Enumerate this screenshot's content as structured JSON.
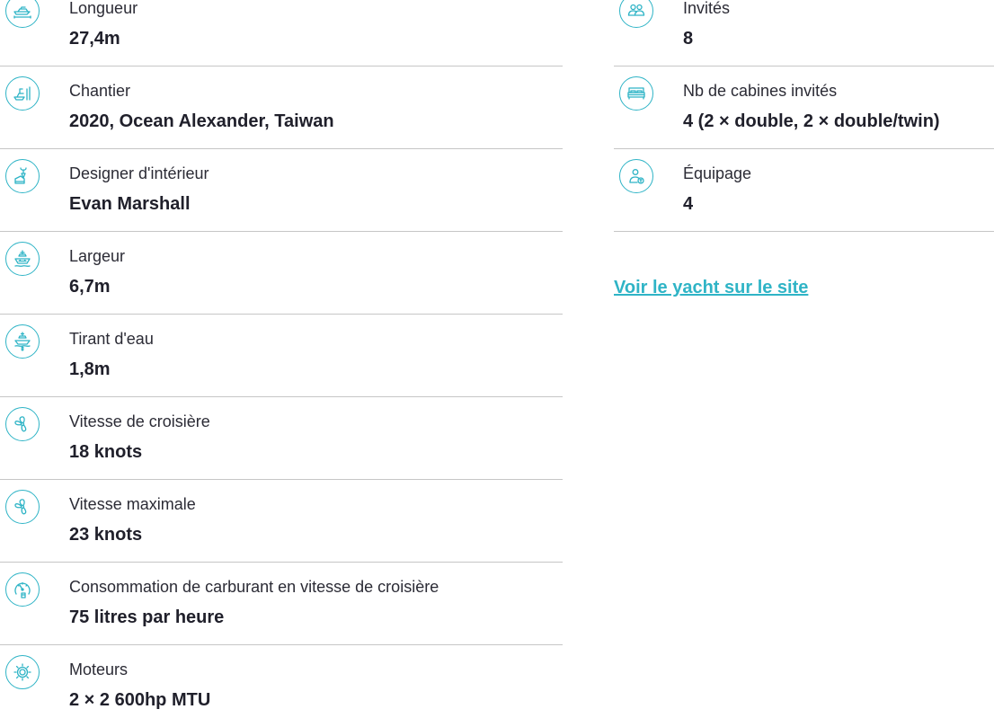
{
  "specs_left": [
    {
      "icon": "yacht-length-icon",
      "label": "Longueur",
      "value": "27,4m"
    },
    {
      "icon": "shipyard-icon",
      "label": "Chantier",
      "value": "2020, Ocean Alexander, Taiwan"
    },
    {
      "icon": "interior-designer-icon",
      "label": "Designer d'intérieur",
      "value": "Evan Marshall"
    },
    {
      "icon": "beam-width-icon",
      "label": "Largeur",
      "value": "6,7m"
    },
    {
      "icon": "draft-icon",
      "label": "Tirant d'eau",
      "value": "1,8m"
    },
    {
      "icon": "propeller-icon",
      "label": "Vitesse de croisière",
      "value": "18 knots"
    },
    {
      "icon": "propeller-icon",
      "label": "Vitesse maximale",
      "value": "23 knots"
    },
    {
      "icon": "fuel-gauge-icon",
      "label": "Consommation de carburant en vitesse de croisière",
      "value": "75 litres par heure"
    },
    {
      "icon": "engine-gear-icon",
      "label": "Moteurs",
      "value": "2 × 2 600hp MTU"
    }
  ],
  "specs_right": [
    {
      "icon": "guests-icon",
      "label": "Invités",
      "value": "8"
    },
    {
      "icon": "bed-icon",
      "label": "Nb de cabines invités",
      "value": "4 (2 × double, 2 × double/twin)"
    },
    {
      "icon": "crew-icon",
      "label": "Équipage",
      "value": "4"
    }
  ],
  "link": {
    "label": "Voir le yacht sur le site"
  },
  "colors": {
    "accent": "#2fb4c6",
    "divider": "#c6c6c6",
    "text": "#20202b"
  }
}
